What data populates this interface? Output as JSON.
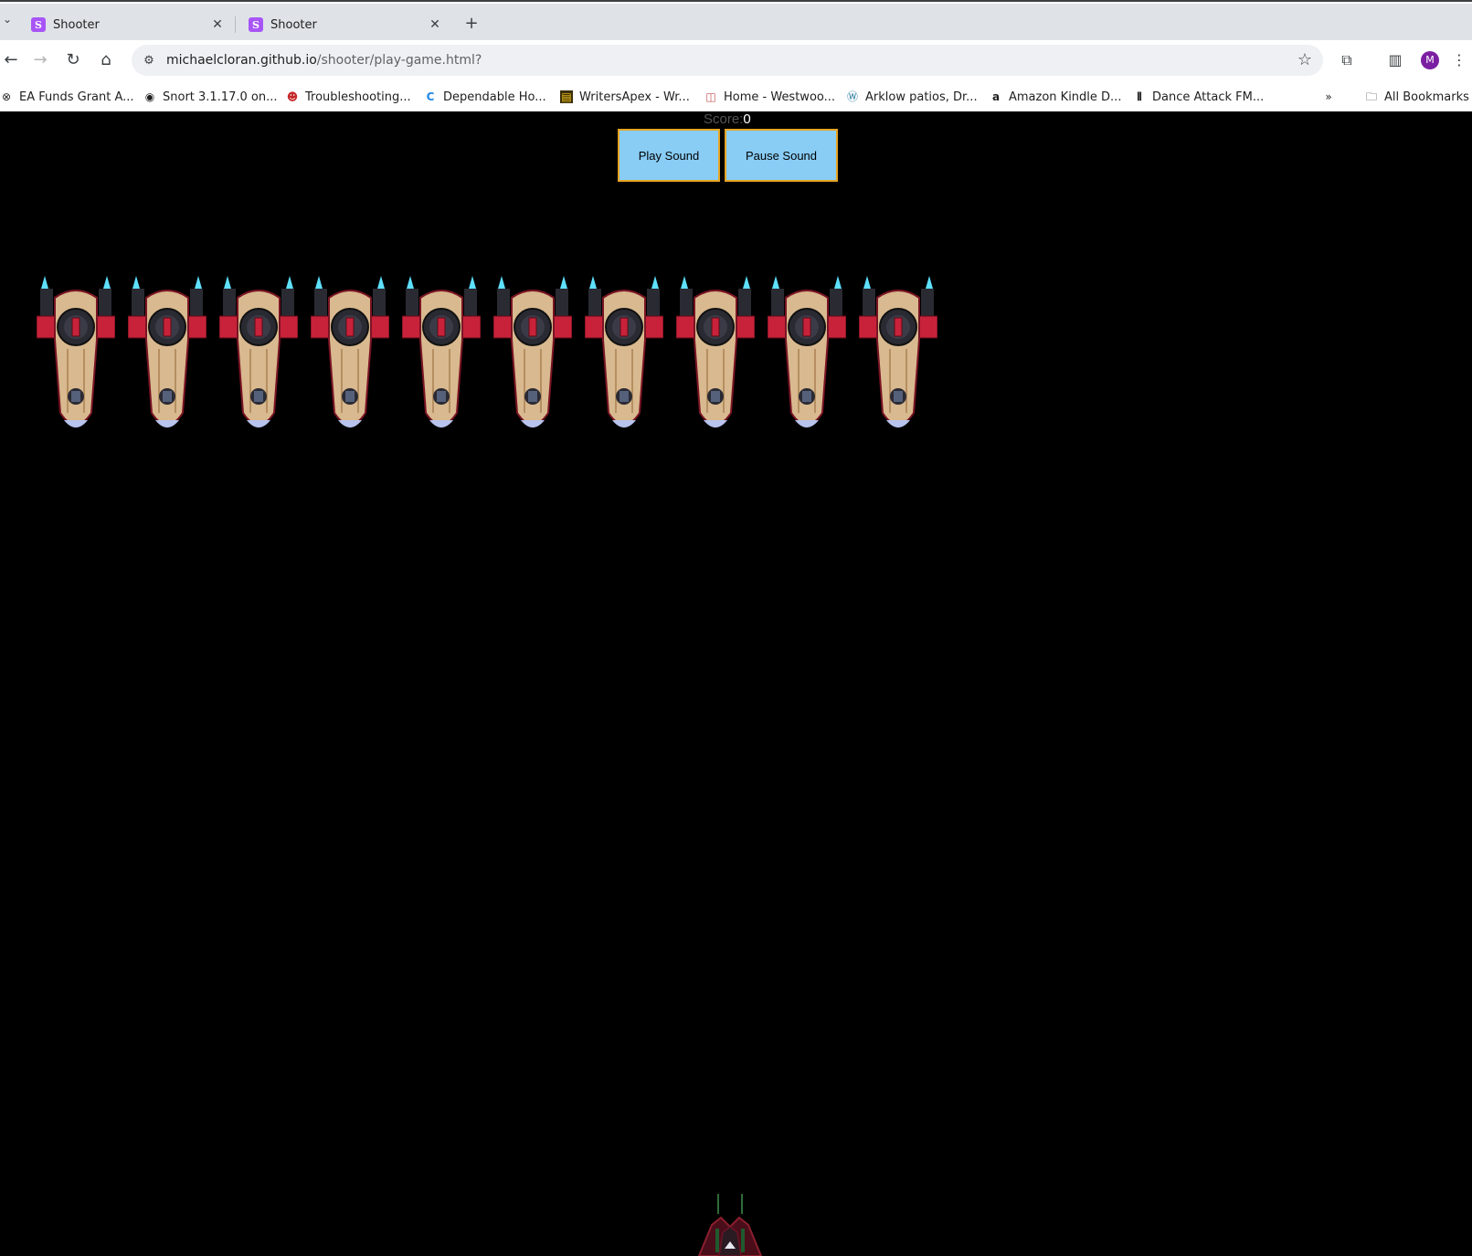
{
  "browser": {
    "tabs": [
      {
        "title": "Shooter",
        "favicon": "S"
      },
      {
        "title": "Shooter",
        "favicon": "S"
      }
    ],
    "url_host": "michaelcloran.github.io",
    "url_path": "/shooter/play-game.html?",
    "avatar_letter": "M",
    "bookmarks": [
      {
        "label": "EA Funds Grant A...",
        "icon": "ea-icon"
      },
      {
        "label": "Snort 3.1.17.0 on...",
        "icon": "globe-icon"
      },
      {
        "label": "Troubleshooting...",
        "icon": "devil-icon"
      },
      {
        "label": "Dependable Ho...",
        "icon": "c-icon"
      },
      {
        "label": "WritersApex - Wr...",
        "icon": "book-icon"
      },
      {
        "label": "Home - Westwoo...",
        "icon": "box-icon"
      },
      {
        "label": "Arklow patios, Dr...",
        "icon": "wordpress-icon"
      },
      {
        "label": "Amazon Kindle D...",
        "icon": "amazon-icon"
      },
      {
        "label": "Dance Attack FM...",
        "icon": "bars-icon"
      }
    ],
    "all_bookmarks_label": "All Bookmarks"
  },
  "game": {
    "score_label": "Score:",
    "score_value": "0",
    "play_button": "Play Sound",
    "pause_button": "Pause Sound",
    "enemy_count": 10,
    "colors": {
      "enemy_hull": "#d9b98f",
      "enemy_red": "#c8223a",
      "enemy_dark": "#2a2a33",
      "thruster": "#5ee0ff",
      "button_bg": "#89cdf5",
      "button_border": "#e6a523"
    }
  }
}
